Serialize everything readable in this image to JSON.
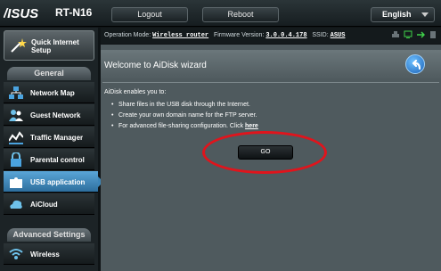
{
  "header": {
    "brand": "/ISUS",
    "model": "RT-N16",
    "logout_label": "Logout",
    "reboot_label": "Reboot",
    "language": "English"
  },
  "status": {
    "operation_mode_label": "Operation Mode:",
    "operation_mode_value": "Wireless router",
    "firmware_label": "Firmware Version:",
    "firmware_value": "3.0.0.4.178",
    "ssid_label": "SSID:",
    "ssid_value": "ASUS"
  },
  "sidebar": {
    "quick_setup": "Quick Internet Setup",
    "general_title": "General",
    "items": [
      {
        "label": "Network Map"
      },
      {
        "label": "Guest Network"
      },
      {
        "label": "Traffic Manager"
      },
      {
        "label": "Parental control"
      },
      {
        "label": "USB application"
      },
      {
        "label": "AiCloud"
      }
    ],
    "advanced_title": "Advanced Settings",
    "advanced_items": [
      {
        "label": "Wireless"
      }
    ]
  },
  "main": {
    "title": "Welcome to AiDisk wizard",
    "intro": "AiDisk enables you to:",
    "bullets": [
      "Share files in the USB disk through the Internet.",
      "Create your own domain name for the FTP server."
    ],
    "advanced_text": "For advanced file-sharing configuration. Click",
    "here_link": "here",
    "go_label": "GO"
  },
  "colors": {
    "accent": "#3c85b8",
    "highlight_ring": "#e0141c"
  }
}
